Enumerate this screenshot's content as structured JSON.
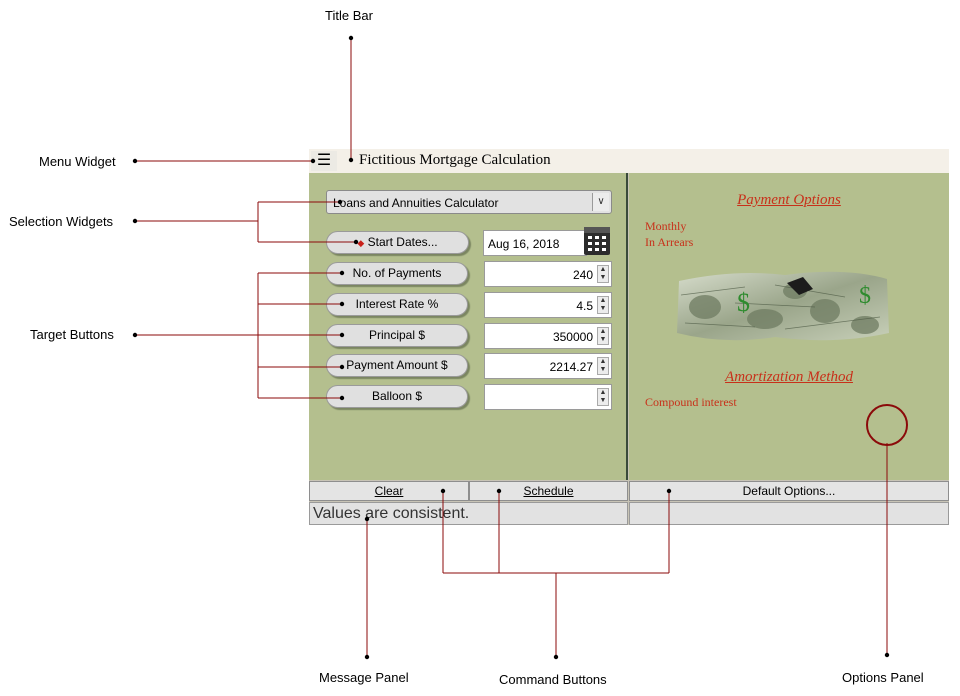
{
  "annotations": {
    "title_bar": "Title Bar",
    "menu_widget": "Menu Widget",
    "selection_widgets": "Selection Widgets",
    "target_buttons": "Target Buttons",
    "message_panel": "Message Panel",
    "command_buttons": "Command Buttons",
    "options_panel": "Options Panel"
  },
  "app": {
    "menu_icon": "☰",
    "title": "Fictitious Mortgage Calculation",
    "calculator_select": "Loans and Annuities Calculator",
    "start_dates_button": "Start Dates...",
    "start_date_value": "Aug 16, 2018",
    "targets": [
      {
        "label": "No. of Payments",
        "value": "240"
      },
      {
        "label": "Interest Rate %",
        "value": "4.5"
      },
      {
        "label": "Principal $",
        "value": "350000"
      },
      {
        "label": "Payment Amount $",
        "value": "2214.27"
      },
      {
        "label": "Balloon $",
        "value": ""
      }
    ],
    "commands": {
      "clear": "Clear",
      "schedule": "Schedule",
      "default_options": "Default Options..."
    },
    "status_message": "Values are consistent.",
    "options": {
      "payment_options_title": "Payment Options",
      "payment_frequency": "Monthly",
      "payment_timing": "In Arrears",
      "amortization_title": "Amortization Method",
      "amortization_value": "Compound interest"
    }
  },
  "icons": {
    "menu": "hamburger-menu-icon",
    "calendar": "calendar-icon",
    "dropdown": "chevron-down-icon",
    "spinner": "spinner-icon"
  },
  "colors": {
    "panel_bg": "#b4bf8e",
    "title_bar_bg": "#f4f0e8",
    "options_text": "#c8301a",
    "leader_lines": "#8b0a0a"
  }
}
